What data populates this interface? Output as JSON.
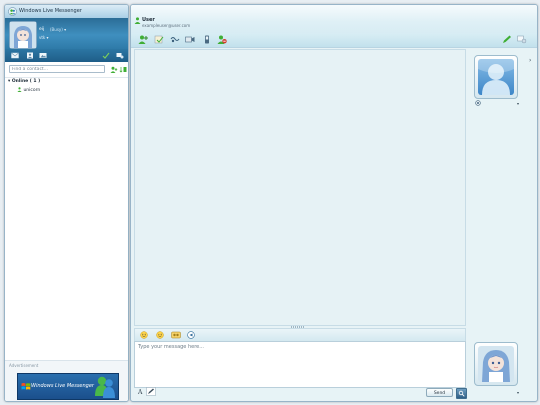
{
  "contact_window": {
    "title": "Windows Live Messenger",
    "user": {
      "name": "eij",
      "status": "(Busy)",
      "personal_message": "vtk"
    },
    "search": {
      "placeholder": "Find a contact..."
    },
    "groups": [
      {
        "label": "Online ( 1 )",
        "contacts": [
          {
            "name": "unicorn"
          }
        ]
      }
    ],
    "ad": {
      "label": "Advertisement",
      "banner_text": "Windows Live Messenger"
    }
  },
  "chat_window": {
    "contact": {
      "name": "User",
      "email": "exampleuser@user.com"
    },
    "compose": {
      "placeholder": "Type your message here..."
    },
    "send_label": "Send",
    "font_label": "A"
  },
  "colors": {
    "header_blue": "#3f8fbf",
    "chat_bg": "#e7f3f6",
    "presence_green": "#3fae34",
    "busy_red": "#d23b2d"
  },
  "icons": {
    "left_toolbar": [
      "mail-icon",
      "contacts-icon",
      "photos-icon",
      "check-icon",
      "options-icon"
    ],
    "chat_toolbar": [
      "invite-icon",
      "send-files-icon",
      "video-call-icon",
      "call-icon",
      "phone-icon",
      "block-icon",
      "pen-icon",
      "options-icon"
    ],
    "format_toolbar": [
      "emoticon-icon",
      "wink-icon",
      "nudge-icon",
      "voice-clip-icon"
    ]
  }
}
